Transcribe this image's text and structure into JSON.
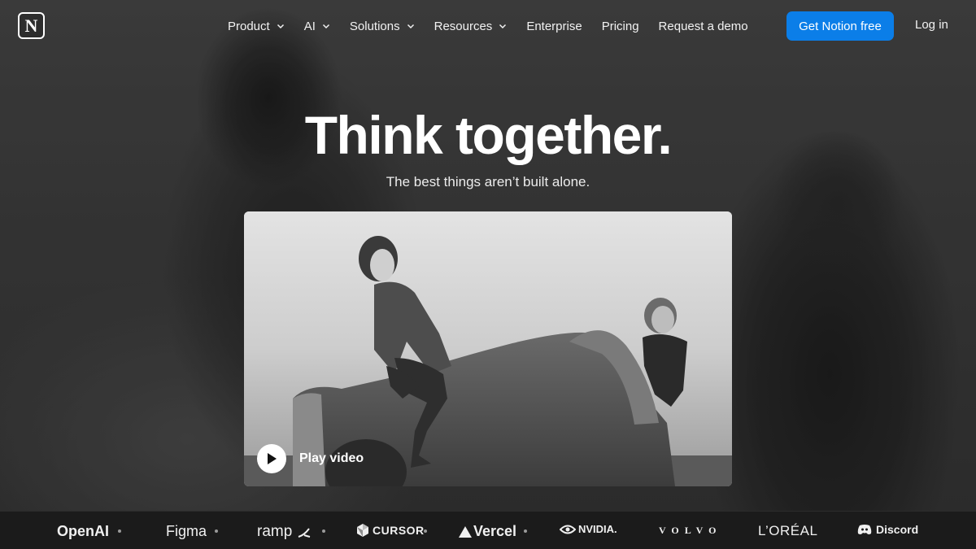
{
  "nav": {
    "logo_letter": "N",
    "items": [
      {
        "label": "Product",
        "dropdown": true
      },
      {
        "label": "AI",
        "dropdown": true
      },
      {
        "label": "Solutions",
        "dropdown": true
      },
      {
        "label": "Resources",
        "dropdown": true
      },
      {
        "label": "Enterprise",
        "dropdown": false
      },
      {
        "label": "Pricing",
        "dropdown": false
      },
      {
        "label": "Request a demo",
        "dropdown": false
      }
    ],
    "cta_label": "Get Notion free",
    "login_label": "Log in"
  },
  "hero": {
    "headline": "Think together.",
    "subheadline": "The best things aren’t built alone."
  },
  "video": {
    "play_label": "Play video",
    "icon": "play-icon"
  },
  "logos": [
    "OpenAI",
    "Figma",
    "ramp",
    "CURSOR",
    "Vercel",
    "NVIDIA.",
    "VOLVO",
    "L’ORÉAL",
    "Discord"
  ],
  "colors": {
    "cta": "#0b7ee8",
    "logo_strip": "#1b1b1b",
    "text": "#ffffff"
  }
}
